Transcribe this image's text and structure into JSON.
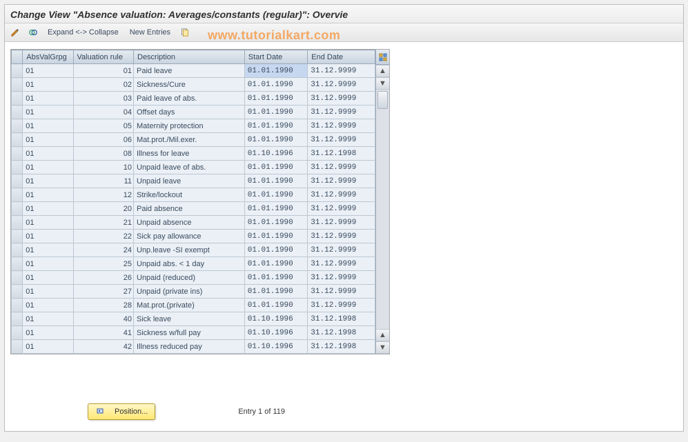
{
  "title": "Change View \"Absence valuation: Averages/constants (regular)\": Overvie",
  "watermark": "www.tutorialkart.com",
  "toolbar": {
    "expand_collapse": "Expand <-> Collapse",
    "new_entries": "New Entries"
  },
  "columns": {
    "absvalgrpg": "AbsValGrpg",
    "valuation_rule": "Valuation rule",
    "description": "Description",
    "start_date": "Start Date",
    "end_date": "End Date"
  },
  "rows": [
    {
      "grp": "01",
      "rule": "01",
      "desc": "Paid leave",
      "start": "01.01.1990",
      "end": "31.12.9999"
    },
    {
      "grp": "01",
      "rule": "02",
      "desc": "Sickness/Cure",
      "start": "01.01.1990",
      "end": "31.12.9999"
    },
    {
      "grp": "01",
      "rule": "03",
      "desc": "Paid leave of abs.",
      "start": "01.01.1990",
      "end": "31.12.9999"
    },
    {
      "grp": "01",
      "rule": "04",
      "desc": "Offset days",
      "start": "01.01.1990",
      "end": "31.12.9999"
    },
    {
      "grp": "01",
      "rule": "05",
      "desc": "Maternity protection",
      "start": "01.01.1990",
      "end": "31.12.9999"
    },
    {
      "grp": "01",
      "rule": "06",
      "desc": "Mat.prot./Mil.exer.",
      "start": "01.01.1990",
      "end": "31.12.9999"
    },
    {
      "grp": "01",
      "rule": "08",
      "desc": "Illness for leave",
      "start": "01.10.1996",
      "end": "31.12.1998"
    },
    {
      "grp": "01",
      "rule": "10",
      "desc": "Unpaid leave of abs.",
      "start": "01.01.1990",
      "end": "31.12.9999"
    },
    {
      "grp": "01",
      "rule": "11",
      "desc": "Unpaid leave",
      "start": "01.01.1990",
      "end": "31.12.9999"
    },
    {
      "grp": "01",
      "rule": "12",
      "desc": "Strike/lockout",
      "start": "01.01.1990",
      "end": "31.12.9999"
    },
    {
      "grp": "01",
      "rule": "20",
      "desc": "Paid absence",
      "start": "01.01.1990",
      "end": "31.12.9999"
    },
    {
      "grp": "01",
      "rule": "21",
      "desc": "Unpaid absence",
      "start": "01.01.1990",
      "end": "31.12.9999"
    },
    {
      "grp": "01",
      "rule": "22",
      "desc": "Sick pay allowance",
      "start": "01.01.1990",
      "end": "31.12.9999"
    },
    {
      "grp": "01",
      "rule": "24",
      "desc": "Unp.leave -SI exempt",
      "start": "01.01.1990",
      "end": "31.12.9999"
    },
    {
      "grp": "01",
      "rule": "25",
      "desc": "Unpaid abs. < 1 day",
      "start": "01.01.1990",
      "end": "31.12.9999"
    },
    {
      "grp": "01",
      "rule": "26",
      "desc": "Unpaid (reduced)",
      "start": "01.01.1990",
      "end": "31.12.9999"
    },
    {
      "grp": "01",
      "rule": "27",
      "desc": "Unpaid (private ins)",
      "start": "01.01.1990",
      "end": "31.12.9999"
    },
    {
      "grp": "01",
      "rule": "28",
      "desc": "Mat.prot.(private)",
      "start": "01.01.1990",
      "end": "31.12.9999"
    },
    {
      "grp": "01",
      "rule": "40",
      "desc": "Sick leave",
      "start": "01.10.1996",
      "end": "31.12.1998"
    },
    {
      "grp": "01",
      "rule": "41",
      "desc": "Sickness w/full pay",
      "start": "01.10.1996",
      "end": "31.12.1998"
    },
    {
      "grp": "01",
      "rule": "42",
      "desc": "Illness reduced pay",
      "start": "01.10.1996",
      "end": "31.12.1998"
    }
  ],
  "position_button": "Position...",
  "entry_count": "Entry 1 of 119"
}
